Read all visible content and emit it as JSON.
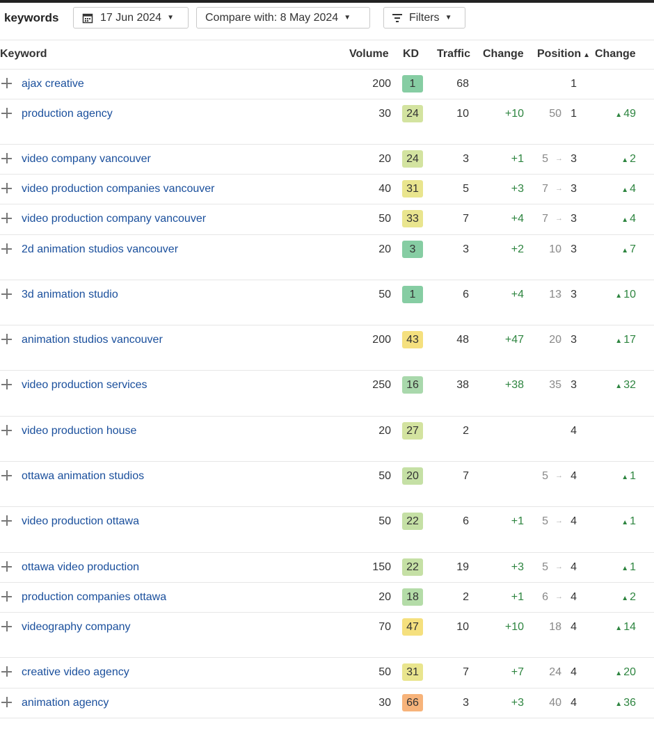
{
  "toolbar": {
    "title": "keywords",
    "date_label": "17 Jun 2024",
    "compare_label": "Compare with: 8 May 2024",
    "filters_label": "Filters"
  },
  "columns": {
    "keyword": "Keyword",
    "volume": "Volume",
    "kd": "KD",
    "traffic": "Traffic",
    "traffic_change": "Change",
    "position": "Position",
    "position_change": "Change"
  },
  "colors": {
    "kd_green": "#86cda3",
    "kd_lightgreen": "#c5e0a5",
    "kd_olive": "#d3e3a0",
    "kd_yellow": "#f5e07e",
    "kd_orange": "#f7b37a",
    "positive": "#2e8540",
    "link": "#1a4f9c"
  },
  "rows": [
    {
      "keyword": "ajax creative",
      "volume": "200",
      "kd": "1",
      "kd_color": "#86cda3",
      "traffic": "68",
      "traffic_change": "",
      "pos_from": "",
      "pos_to": "1",
      "pos_change": ""
    },
    {
      "keyword": "production agency",
      "volume": "30",
      "kd": "24",
      "kd_color": "#d3e3a0",
      "traffic": "10",
      "traffic_change": "+10",
      "pos_from": "50",
      "pos_to": "1",
      "pos_change": "49"
    },
    {
      "keyword": "video company vancouver",
      "volume": "20",
      "kd": "24",
      "kd_color": "#d3e3a0",
      "traffic": "3",
      "traffic_change": "+1",
      "pos_from": "5",
      "pos_to": "3",
      "pos_change": "2"
    },
    {
      "keyword": "video production companies vancouver",
      "volume": "40",
      "kd": "31",
      "kd_color": "#e9e58e",
      "traffic": "5",
      "traffic_change": "+3",
      "pos_from": "7",
      "pos_to": "3",
      "pos_change": "4"
    },
    {
      "keyword": "video production company vancouver",
      "volume": "50",
      "kd": "33",
      "kd_color": "#e9e58e",
      "traffic": "7",
      "traffic_change": "+4",
      "pos_from": "7",
      "pos_to": "3",
      "pos_change": "4"
    },
    {
      "keyword": "2d animation studios vancouver",
      "volume": "20",
      "kd": "3",
      "kd_color": "#86cda3",
      "traffic": "3",
      "traffic_change": "+2",
      "pos_from": "10",
      "pos_to": "3",
      "pos_change": "7"
    },
    {
      "keyword": "3d animation studio",
      "volume": "50",
      "kd": "1",
      "kd_color": "#86cda3",
      "traffic": "6",
      "traffic_change": "+4",
      "pos_from": "13",
      "pos_to": "3",
      "pos_change": "10"
    },
    {
      "keyword": "animation studios vancouver",
      "volume": "200",
      "kd": "43",
      "kd_color": "#f5e07e",
      "traffic": "48",
      "traffic_change": "+47",
      "pos_from": "20",
      "pos_to": "3",
      "pos_change": "17"
    },
    {
      "keyword": "video production services",
      "volume": "250",
      "kd": "16",
      "kd_color": "#a9d8ac",
      "traffic": "38",
      "traffic_change": "+38",
      "pos_from": "35",
      "pos_to": "3",
      "pos_change": "32"
    },
    {
      "keyword": "video production house",
      "volume": "20",
      "kd": "27",
      "kd_color": "#d3e3a0",
      "traffic": "2",
      "traffic_change": "",
      "pos_from": "",
      "pos_to": "4",
      "pos_change": ""
    },
    {
      "keyword": "ottawa animation studios",
      "volume": "50",
      "kd": "20",
      "kd_color": "#c5e0a5",
      "traffic": "7",
      "traffic_change": "",
      "pos_from": "5",
      "pos_to": "4",
      "pos_change": "1"
    },
    {
      "keyword": "video production ottawa",
      "volume": "50",
      "kd": "22",
      "kd_color": "#c5e0a5",
      "traffic": "6",
      "traffic_change": "+1",
      "pos_from": "5",
      "pos_to": "4",
      "pos_change": "1"
    },
    {
      "keyword": "ottawa video production",
      "volume": "150",
      "kd": "22",
      "kd_color": "#c5e0a5",
      "traffic": "19",
      "traffic_change": "+3",
      "pos_from": "5",
      "pos_to": "4",
      "pos_change": "1"
    },
    {
      "keyword": "production companies ottawa",
      "volume": "20",
      "kd": "18",
      "kd_color": "#b4dca8",
      "traffic": "2",
      "traffic_change": "+1",
      "pos_from": "6",
      "pos_to": "4",
      "pos_change": "2"
    },
    {
      "keyword": "videography company",
      "volume": "70",
      "kd": "47",
      "kd_color": "#f5e07e",
      "traffic": "10",
      "traffic_change": "+10",
      "pos_from": "18",
      "pos_to": "4",
      "pos_change": "14"
    },
    {
      "keyword": "creative video agency",
      "volume": "50",
      "kd": "31",
      "kd_color": "#e9e58e",
      "traffic": "7",
      "traffic_change": "+7",
      "pos_from": "24",
      "pos_to": "4",
      "pos_change": "20"
    },
    {
      "keyword": "animation agency",
      "volume": "30",
      "kd": "66",
      "kd_color": "#f7b37a",
      "traffic": "3",
      "traffic_change": "+3",
      "pos_from": "40",
      "pos_to": "4",
      "pos_change": "36"
    }
  ]
}
